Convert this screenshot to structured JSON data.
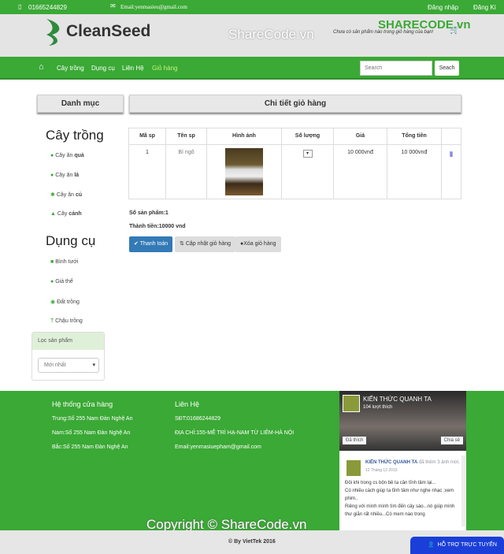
{
  "topbar": {
    "phone": "01665244829",
    "email": "Email:yenmasieu@gmail.com",
    "login": "Đăng nhập",
    "register": "Đăng Kí"
  },
  "header": {
    "logo": "CleanSeed",
    "cart_text": "Chưa có sản phẩm nào trong giỏ hàng của bạn!",
    "watermark": "ShareCode.vn",
    "brand_watermark": "SHARECODE.vn"
  },
  "nav": {
    "items": [
      "Cây trồng",
      "Dụng cụ",
      "Liên Hệ",
      "Giỏ hàng"
    ],
    "search_placeholder": "Search",
    "search_button": "Seach"
  },
  "sidebar": {
    "title": "Danh mục",
    "group1": "Cây trồng",
    "group1_items": [
      [
        "Cây ăn ",
        "quả"
      ],
      [
        "Cây ăn ",
        "lá"
      ],
      [
        "Cây ăn ",
        "củ"
      ],
      [
        "Cây ",
        "cảnh"
      ]
    ],
    "group2": "Dụng cụ",
    "group2_items": [
      "Bình tưới",
      "Giá thể",
      "Đất trồng",
      "Chậu trồng"
    ],
    "filter_title": "Lọc sản phẩm",
    "filter_value": "Mới nhất"
  },
  "cart": {
    "title": "Chi tiết giỏ hàng",
    "columns": [
      "Mã sp",
      "Tên sp",
      "Hình ảnh",
      "Số lượng",
      "Giá",
      "Tổng tiền",
      ""
    ],
    "rows": [
      {
        "id": "1",
        "name": "Bí ngô",
        "price": "10 000vnđ",
        "total": "10 000vnđ"
      }
    ],
    "count": "Số sản phẩm:1",
    "amount": "Thành tiền:10000 vnd",
    "pay": "Thanh toán",
    "update": "Cập nhật giỏ hàng",
    "clear": "Xóa giỏ hàng"
  },
  "footer": {
    "stores_title": "Hệ thống cửa hàng",
    "stores": [
      "Trung:Số 255 Nam Đàn Nghệ An",
      "Nam:Số 255 Nam Đàn Nghệ An",
      "Bắc:Số 255 Nam Đàn Nghệ An"
    ],
    "contact_title": "Liên Hệ",
    "contact": [
      "SĐT:01686244829",
      "ĐỊA CHỈ:155-MỄ TRÌ HẠ-NAM TỪ LIÊM-HÀ NỘI",
      "Email:yenmasiuepham@gmail.com"
    ],
    "fb": {
      "page": "KIẾN THỨC QUANH TA",
      "likes": "104 lượt thích",
      "liked": "Đã thích",
      "share": "Chia sẻ",
      "post_author": "KIẾN THỨC QUANH TA",
      "post_action": " đã thêm 3 ảnh mới.",
      "post_date": "12 Tháng 12 2015",
      "post_lines": [
        "Đôi khi trong cs bộn bề ta cần tĩnh tâm lại...",
        "Có nhiều cách giúp ta tĩnh tâm như nghe nhạc ;xem phim..",
        "Riêng với mình mình tìm đến cây sáo...nó giúp mình thư giãn rất nhiều...Có mem nào trong"
      ]
    },
    "copyright_watermark": "Copyright © ShareCode.vn",
    "credit": "© By VietTek 2016",
    "support": "HỖ TRỢ TRỰC TUYẾN"
  },
  "colors": {
    "green": "#3aa935",
    "blue": "#337ab7",
    "support": "#1a3fd9"
  }
}
